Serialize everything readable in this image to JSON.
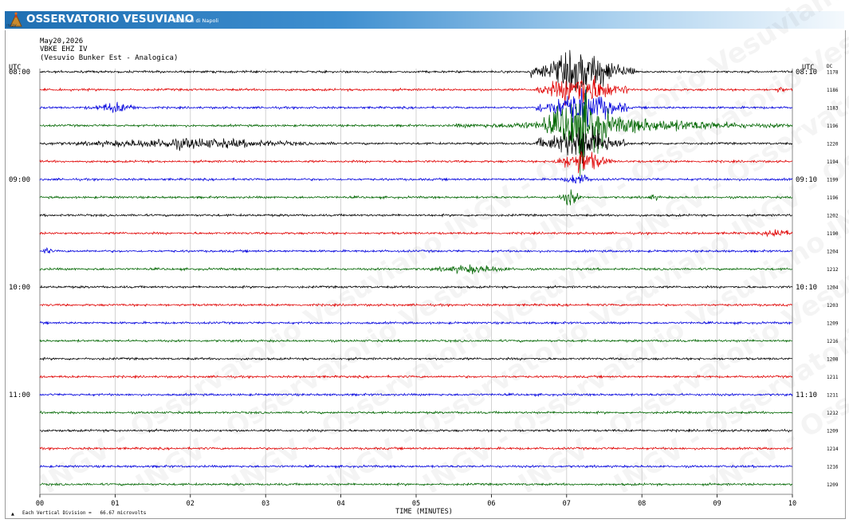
{
  "header": {
    "brand": "OSSERVATORIO VESUVIANO",
    "subtitle": "Sezione di Napoli",
    "logo_text": "INGV"
  },
  "info": {
    "date": "May20,2026",
    "station": "VBKE EHZ IV",
    "site": "(Vesuvio Bunker Est - Analogica)"
  },
  "chart_data": {
    "type": "line",
    "title": "May20,2026 VBKE EHZ IV (Vesuvio Bunker Est - Analogica)",
    "xlabel": "TIME (MINUTES)",
    "xlim": [
      0,
      10
    ],
    "x_ticks": [
      "00",
      "01",
      "02",
      "03",
      "04",
      "05",
      "06",
      "07",
      "08",
      "09",
      "10"
    ],
    "left_axis_label": "UTC",
    "right_axis_label": "UTC",
    "dc_label": "DC",
    "left_hour_labels": [
      {
        "row": 0,
        "text": "08:00"
      },
      {
        "row": 6,
        "text": "09:00"
      },
      {
        "row": 12,
        "text": "10:00"
      },
      {
        "row": 18,
        "text": "11:00"
      }
    ],
    "right_hour_labels": [
      {
        "row": 0,
        "text": "08:10"
      },
      {
        "row": 6,
        "text": "09:10"
      },
      {
        "row": 12,
        "text": "10:10"
      },
      {
        "row": 18,
        "text": "11:10"
      }
    ],
    "trace_colors": [
      "#000000",
      "#e00000",
      "#0000dd",
      "#006600"
    ],
    "series": [
      {
        "row": 0,
        "color": "#000000",
        "dc": "1178"
      },
      {
        "row": 1,
        "color": "#e00000",
        "dc": "1186"
      },
      {
        "row": 2,
        "color": "#0000dd",
        "dc": "1183"
      },
      {
        "row": 3,
        "color": "#006600",
        "dc": "1196"
      },
      {
        "row": 4,
        "color": "#000000",
        "dc": "1220"
      },
      {
        "row": 5,
        "color": "#e00000",
        "dc": "1194"
      },
      {
        "row": 6,
        "color": "#0000dd",
        "dc": "1199"
      },
      {
        "row": 7,
        "color": "#006600",
        "dc": "1196"
      },
      {
        "row": 8,
        "color": "#000000",
        "dc": "1202"
      },
      {
        "row": 9,
        "color": "#e00000",
        "dc": "1190"
      },
      {
        "row": 10,
        "color": "#0000dd",
        "dc": "1204"
      },
      {
        "row": 11,
        "color": "#006600",
        "dc": "1212"
      },
      {
        "row": 12,
        "color": "#000000",
        "dc": "1204"
      },
      {
        "row": 13,
        "color": "#e00000",
        "dc": "1203"
      },
      {
        "row": 14,
        "color": "#0000dd",
        "dc": "1209"
      },
      {
        "row": 15,
        "color": "#006600",
        "dc": "1216"
      },
      {
        "row": 16,
        "color": "#000000",
        "dc": "1208"
      },
      {
        "row": 17,
        "color": "#e00000",
        "dc": "1211"
      },
      {
        "row": 18,
        "color": "#0000dd",
        "dc": "1211"
      },
      {
        "row": 19,
        "color": "#006600",
        "dc": "1212"
      },
      {
        "row": 20,
        "color": "#000000",
        "dc": "1209"
      },
      {
        "row": 21,
        "color": "#e00000",
        "dc": "1214"
      },
      {
        "row": 22,
        "color": "#0000dd",
        "dc": "1216"
      },
      {
        "row": 23,
        "color": "#006600",
        "dc": "1209"
      }
    ],
    "events": [
      {
        "row": 0,
        "from": 6.5,
        "to": 7.9,
        "amplitude": 34
      },
      {
        "row": 1,
        "from": 6.6,
        "to": 7.8,
        "amplitude": 28
      },
      {
        "row": 1,
        "from": 9.7,
        "to": 10.0,
        "amplitude": 5
      },
      {
        "row": 2,
        "from": 0.6,
        "to": 1.4,
        "amplitude": 9
      },
      {
        "row": 2,
        "from": 6.6,
        "to": 7.8,
        "amplitude": 30
      },
      {
        "row": 3,
        "from": 5.5,
        "to": 10.0,
        "amplitude": 12
      },
      {
        "row": 3,
        "from": 6.7,
        "to": 7.7,
        "amplitude": 60
      },
      {
        "row": 4,
        "from": 0.0,
        "to": 4.0,
        "amplitude": 9
      },
      {
        "row": 4,
        "from": 6.6,
        "to": 7.8,
        "amplitude": 30
      },
      {
        "row": 5,
        "from": 6.8,
        "to": 7.6,
        "amplitude": 20
      },
      {
        "row": 6,
        "from": 6.9,
        "to": 7.4,
        "amplitude": 10
      },
      {
        "row": 7,
        "from": 6.9,
        "to": 7.2,
        "amplitude": 14
      },
      {
        "row": 7,
        "from": 8.0,
        "to": 8.3,
        "amplitude": 5
      },
      {
        "row": 9,
        "from": 9.6,
        "to": 10.0,
        "amplitude": 10
      },
      {
        "row": 10,
        "from": 0.0,
        "to": 0.2,
        "amplitude": 6
      },
      {
        "row": 11,
        "from": 5.0,
        "to": 6.5,
        "amplitude": 7
      }
    ]
  },
  "footer": {
    "scale_note": "Each Vertical Division =   66.67 microvolts",
    "scale_marker": "▲"
  },
  "watermark": {
    "text": "INGV - Osservatorio Vesuviano"
  }
}
